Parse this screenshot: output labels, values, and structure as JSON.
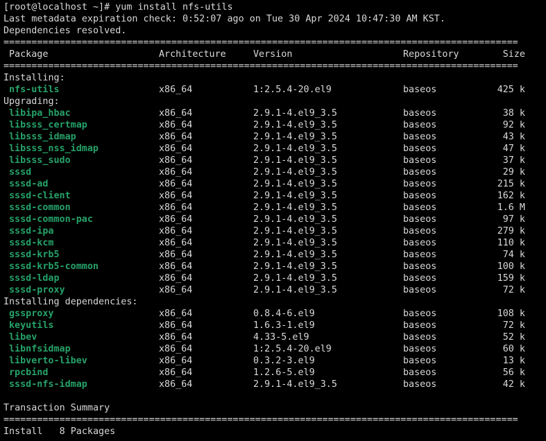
{
  "terminal": {
    "prompt_line": "[root@localhost ~]# yum install nfs-utils",
    "metadata_line": "Last metadata expiration check: 0:52:07 ago on Tue 30 Apr 2024 10:47:30 AM KST.",
    "deps_resolved": "Dependencies resolved.",
    "separator": "============================================================================================",
    "headers": {
      "package": "Package",
      "architecture": "Architecture",
      "version": "Version",
      "repository": "Repository",
      "size": "Size"
    },
    "sections": {
      "installing": "Installing:",
      "upgrading": "Upgrading:",
      "installing_deps": "Installing dependencies:"
    },
    "installing": [
      {
        "name": "nfs-utils",
        "arch": "x86_64",
        "version": "1:2.5.4-20.el9",
        "repo": "baseos",
        "size": "425 k"
      }
    ],
    "upgrading": [
      {
        "name": "libipa_hbac",
        "arch": "x86_64",
        "version": "2.9.1-4.el9_3.5",
        "repo": "baseos",
        "size": "38 k"
      },
      {
        "name": "libsss_certmap",
        "arch": "x86_64",
        "version": "2.9.1-4.el9_3.5",
        "repo": "baseos",
        "size": "92 k"
      },
      {
        "name": "libsss_idmap",
        "arch": "x86_64",
        "version": "2.9.1-4.el9_3.5",
        "repo": "baseos",
        "size": "43 k"
      },
      {
        "name": "libsss_nss_idmap",
        "arch": "x86_64",
        "version": "2.9.1-4.el9_3.5",
        "repo": "baseos",
        "size": "47 k"
      },
      {
        "name": "libsss_sudo",
        "arch": "x86_64",
        "version": "2.9.1-4.el9_3.5",
        "repo": "baseos",
        "size": "37 k"
      },
      {
        "name": "sssd",
        "arch": "x86_64",
        "version": "2.9.1-4.el9_3.5",
        "repo": "baseos",
        "size": "29 k"
      },
      {
        "name": "sssd-ad",
        "arch": "x86_64",
        "version": "2.9.1-4.el9_3.5",
        "repo": "baseos",
        "size": "215 k"
      },
      {
        "name": "sssd-client",
        "arch": "x86_64",
        "version": "2.9.1-4.el9_3.5",
        "repo": "baseos",
        "size": "162 k"
      },
      {
        "name": "sssd-common",
        "arch": "x86_64",
        "version": "2.9.1-4.el9_3.5",
        "repo": "baseos",
        "size": "1.6 M"
      },
      {
        "name": "sssd-common-pac",
        "arch": "x86_64",
        "version": "2.9.1-4.el9_3.5",
        "repo": "baseos",
        "size": "97 k"
      },
      {
        "name": "sssd-ipa",
        "arch": "x86_64",
        "version": "2.9.1-4.el9_3.5",
        "repo": "baseos",
        "size": "279 k"
      },
      {
        "name": "sssd-kcm",
        "arch": "x86_64",
        "version": "2.9.1-4.el9_3.5",
        "repo": "baseos",
        "size": "110 k"
      },
      {
        "name": "sssd-krb5",
        "arch": "x86_64",
        "version": "2.9.1-4.el9_3.5",
        "repo": "baseos",
        "size": "74 k"
      },
      {
        "name": "sssd-krb5-common",
        "arch": "x86_64",
        "version": "2.9.1-4.el9_3.5",
        "repo": "baseos",
        "size": "100 k"
      },
      {
        "name": "sssd-ldap",
        "arch": "x86_64",
        "version": "2.9.1-4.el9_3.5",
        "repo": "baseos",
        "size": "159 k"
      },
      {
        "name": "sssd-proxy",
        "arch": "x86_64",
        "version": "2.9.1-4.el9_3.5",
        "repo": "baseos",
        "size": "72 k"
      }
    ],
    "installing_deps": [
      {
        "name": "gssproxy",
        "arch": "x86_64",
        "version": "0.8.4-6.el9",
        "repo": "baseos",
        "size": "108 k"
      },
      {
        "name": "keyutils",
        "arch": "x86_64",
        "version": "1.6.3-1.el9",
        "repo": "baseos",
        "size": "72 k"
      },
      {
        "name": "libev",
        "arch": "x86_64",
        "version": "4.33-5.el9",
        "repo": "baseos",
        "size": "52 k"
      },
      {
        "name": "libnfsidmap",
        "arch": "x86_64",
        "version": "1:2.5.4-20.el9",
        "repo": "baseos",
        "size": "60 k"
      },
      {
        "name": "libverto-libev",
        "arch": "x86_64",
        "version": "0.3.2-3.el9",
        "repo": "baseos",
        "size": "13 k"
      },
      {
        "name": "rpcbind",
        "arch": "x86_64",
        "version": "1.2.6-5.el9",
        "repo": "baseos",
        "size": "56 k"
      },
      {
        "name": "sssd-nfs-idmap",
        "arch": "x86_64",
        "version": "2.9.1-4.el9_3.5",
        "repo": "baseos",
        "size": "42 k"
      }
    ],
    "transaction_summary": "Transaction Summary",
    "install_summary": "Install   8 Packages",
    "colors": {
      "background": "#000000",
      "text": "#d9d9d9",
      "package_name": "#26a269"
    }
  }
}
